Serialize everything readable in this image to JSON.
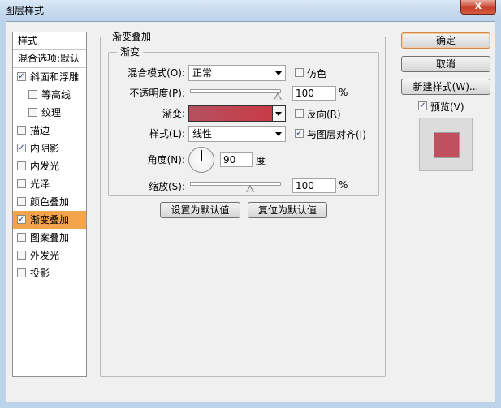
{
  "window": {
    "title": "图层样式",
    "close_glyph": "x"
  },
  "left_panel": {
    "header": "样式",
    "blend_options": "混合选项:默认",
    "items": [
      {
        "label": "斜面和浮雕",
        "checked": true,
        "sub": false,
        "selected": false
      },
      {
        "label": "等高线",
        "checked": false,
        "sub": true,
        "selected": false
      },
      {
        "label": "纹理",
        "checked": false,
        "sub": true,
        "selected": false
      },
      {
        "label": "描边",
        "checked": false,
        "sub": false,
        "selected": false
      },
      {
        "label": "内阴影",
        "checked": true,
        "sub": false,
        "selected": false
      },
      {
        "label": "内发光",
        "checked": false,
        "sub": false,
        "selected": false
      },
      {
        "label": "光泽",
        "checked": false,
        "sub": false,
        "selected": false
      },
      {
        "label": "颜色叠加",
        "checked": false,
        "sub": false,
        "selected": false
      },
      {
        "label": "渐变叠加",
        "checked": true,
        "sub": false,
        "selected": true
      },
      {
        "label": "图案叠加",
        "checked": false,
        "sub": false,
        "selected": false
      },
      {
        "label": "外发光",
        "checked": false,
        "sub": false,
        "selected": false
      },
      {
        "label": "投影",
        "checked": false,
        "sub": false,
        "selected": false
      }
    ]
  },
  "gradient_overlay": {
    "group_title": "渐变叠加",
    "subgroup_title": "渐变",
    "blend_mode_label": "混合模式(O):",
    "blend_mode_value": "正常",
    "dither_label": "仿色",
    "opacity_label": "不透明度(P):",
    "opacity_value": "100",
    "opacity_unit": "%",
    "gradient_label": "渐变:",
    "reverse_label": "反向(R)",
    "style_label": "样式(L):",
    "style_value": "线性",
    "align_label": "与图层对齐(I)",
    "angle_label": "角度(N):",
    "angle_value": "90",
    "angle_unit": "度",
    "scale_label": "缩放(S):",
    "scale_value": "100",
    "scale_unit": "%",
    "make_default": "设置为默认值",
    "reset_default": "复位为默认值",
    "gradient_colors": [
      "#b55160",
      "#c93a47"
    ]
  },
  "right_panel": {
    "ok": "确定",
    "cancel": "取消",
    "new_style": "新建样式(W)...",
    "preview_label": "预览(V)",
    "preview_color": "#c0505d"
  },
  "check_glyph": "✓"
}
